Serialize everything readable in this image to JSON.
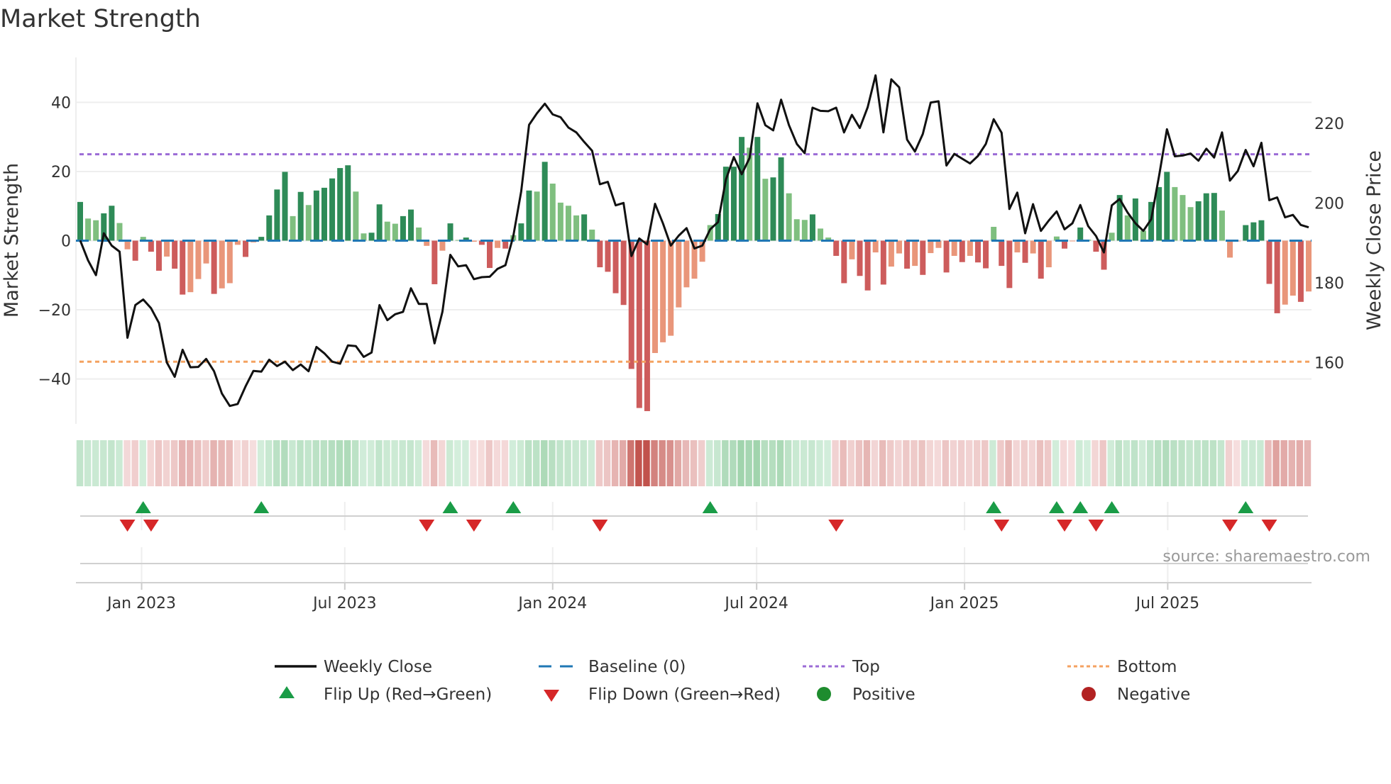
{
  "chart_data": {
    "type": "bar+line",
    "title": "Market Strength",
    "ylabel_left": "Market Strength",
    "ylabel_right": "Weekly Close Price",
    "ylim_left": [
      -53,
      53
    ],
    "ylim_right": [
      144.6,
      236.5
    ],
    "yticks_left": [
      {
        "value": 40,
        "label": "40"
      },
      {
        "value": 20,
        "label": "20"
      },
      {
        "value": 0,
        "label": "0"
      },
      {
        "value": -20,
        "label": "−20"
      },
      {
        "value": -40,
        "label": "−40"
      }
    ],
    "yticks_right": [
      {
        "value": 220,
        "label": "220"
      },
      {
        "value": 200,
        "label": "200"
      },
      {
        "value": 180,
        "label": "180"
      },
      {
        "value": 160,
        "label": "160"
      }
    ],
    "xticks": [
      {
        "week": 7.8,
        "label": "Jan 2023"
      },
      {
        "week": 33.6,
        "label": "Jul 2023"
      },
      {
        "week": 60.0,
        "label": "Jan 2024"
      },
      {
        "week": 85.9,
        "label": "Jul 2024"
      },
      {
        "week": 112.3,
        "label": "Jan 2025"
      },
      {
        "week": 138.1,
        "label": "Jul 2025"
      }
    ],
    "top_level": 25,
    "bottom_level": -35,
    "baseline": 0,
    "grid": true,
    "legend_position": "bottom",
    "strength": [
      11.2,
      6.4,
      5.9,
      7.9,
      10.1,
      5.1,
      -2.5,
      -5.8,
      1.1,
      -3.2,
      -8.7,
      -4.6,
      -8.1,
      -15.6,
      -14.9,
      -11.1,
      -6.6,
      -15.4,
      -13.8,
      -12.3,
      -1.2,
      -4.7,
      -0.5,
      1.1,
      7.3,
      14.8,
      19.9,
      7.1,
      14.1,
      10.3,
      14.5,
      15.3,
      18.0,
      21.0,
      21.8,
      14.2,
      2.1,
      2.3,
      10.5,
      5.5,
      4.9,
      7.1,
      9.0,
      3.8,
      -1.5,
      -12.6,
      -2.9,
      5.0,
      0.2,
      0.9,
      -0.3,
      -1.2,
      -7.9,
      -2.1,
      -2.3,
      1.6,
      5.0,
      14.5,
      14.2,
      22.8,
      16.5,
      11.0,
      10.1,
      7.3,
      7.6,
      3.2,
      -7.7,
      -9.0,
      -15.2,
      -18.6,
      -37.1,
      -48.4,
      -49.3,
      -32.5,
      -29.4,
      -27.5,
      -19.3,
      -13.5,
      -11.0,
      -6.1,
      4.5,
      7.7,
      21.4,
      21.4,
      30.0,
      26.9,
      30.0,
      17.9,
      18.3,
      24.1,
      13.7,
      6.2,
      6.0,
      7.6,
      3.5,
      0.9,
      -4.4,
      -12.3,
      -5.4,
      -10.2,
      -14.4,
      -3.4,
      -12.7,
      -7.5,
      -3.7,
      -8.1,
      -7.3,
      -9.9,
      -3.6,
      -2.1,
      -9.2,
      -4.4,
      -6.2,
      -4.4,
      -6.3,
      -8.0,
      4.0,
      -7.3,
      -13.7,
      -3.4,
      -6.4,
      -3.7,
      -11.0,
      -7.7,
      1.2,
      -2.3,
      -0.2,
      3.8,
      0.3,
      -3.2,
      -8.4,
      2.3,
      13.2,
      7.3,
      12.2,
      2.9,
      11.2,
      15.5,
      19.9,
      15.5,
      13.2,
      9.7,
      11.4,
      13.7,
      13.8,
      8.7,
      -4.9,
      -0.2,
      4.5,
      5.3,
      5.9,
      -12.5,
      -21.0,
      -18.5,
      -15.9,
      -17.7,
      -14.7
    ],
    "close": [
      190.6,
      185.6,
      181.9,
      192.4,
      189.3,
      187.8,
      166.2,
      174.4,
      175.8,
      173.6,
      169.9,
      160.0,
      156.4,
      163.2,
      158.8,
      158.9,
      160.9,
      157.8,
      152.2,
      149.1,
      149.6,
      154.0,
      157.9,
      157.7,
      160.7,
      159.1,
      160.2,
      158.1,
      159.5,
      157.8,
      163.9,
      162.3,
      160.2,
      159.7,
      164.3,
      164.1,
      161.4,
      162.5,
      174.4,
      170.6,
      172.1,
      172.7,
      178.6,
      174.7,
      174.7,
      164.8,
      172.7,
      187.0,
      184.1,
      184.4,
      180.9,
      181.4,
      181.5,
      183.5,
      184.4,
      191.7,
      202.9,
      219.6,
      222.5,
      224.9,
      222.2,
      221.5,
      218.9,
      217.7,
      215.3,
      213.1,
      204.7,
      205.3,
      199.4,
      200.0,
      186.7,
      191.1,
      189.6,
      199.8,
      194.9,
      189.3,
      191.8,
      193.7,
      188.6,
      189.3,
      193.4,
      195.2,
      205.9,
      211.5,
      207.2,
      211.3,
      225.0,
      219.5,
      218.2,
      225.9,
      219.5,
      214.8,
      212.5,
      223.9,
      223.1,
      223.0,
      223.9,
      217.7,
      222.1,
      218.8,
      224.0,
      232.0,
      217.7,
      231.0,
      229.0,
      215.9,
      212.9,
      217.3,
      225.2,
      225.5,
      209.4,
      212.3,
      211.1,
      209.9,
      211.8,
      214.8,
      221.0,
      217.6,
      198.5,
      202.6,
      192.4,
      199.7,
      193.0,
      195.6,
      197.9,
      193.4,
      194.9,
      199.5,
      194.2,
      191.7,
      187.6,
      199.4,
      201.0,
      197.6,
      194.9,
      193.0,
      195.9,
      206.8,
      218.5,
      211.7,
      211.9,
      212.4,
      210.6,
      213.6,
      211.4,
      217.7,
      205.6,
      208.0,
      213.3,
      209.2,
      215.1,
      200.7,
      201.4,
      196.4,
      197.0,
      194.5,
      193.9
    ]
  },
  "colors": {
    "pos_strong": "#2e8b57",
    "pos_weak": "#7fbf7f",
    "neg_strong": "#cd5c5c",
    "neg_weak": "#e9967a",
    "baseline": "#1f77b4",
    "top": "#9b6bd6",
    "bottom": "#f4a261",
    "flip_up": "#1a9c47",
    "flip_down": "#d62728",
    "positive": "#1e8c2e",
    "negative": "#b22222"
  },
  "legend": {
    "weekly_close": "Weekly Close",
    "baseline": "Baseline (0)",
    "top": "Top",
    "bottom": "Bottom",
    "flip_up": "Flip Up (Red→Green)",
    "flip_down": "Flip Down (Green→Red)",
    "positive": "Positive",
    "negative": "Negative"
  },
  "source": "source: sharemaestro.com"
}
